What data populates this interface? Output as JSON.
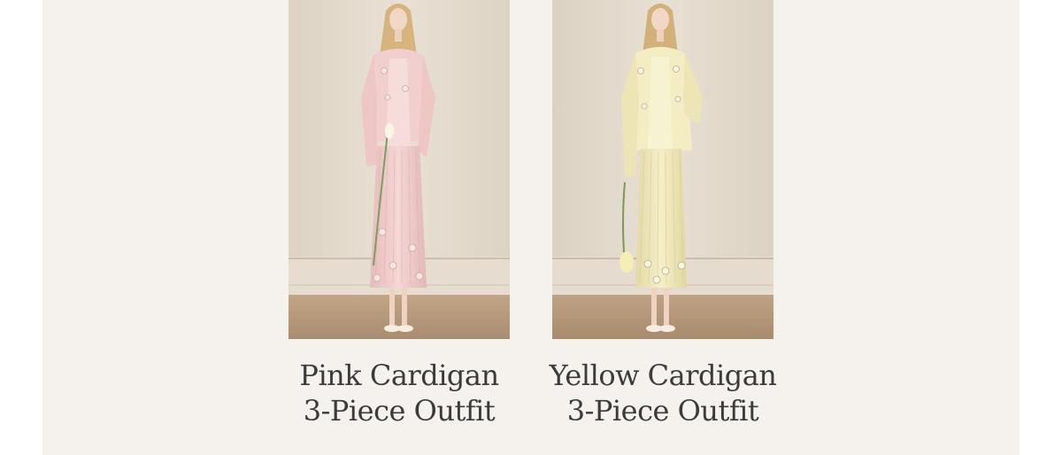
{
  "products": [
    {
      "title_line1": "Pink Cardigan",
      "title_line2": "3-Piece Outfit",
      "image_alt": "Model wearing pink knit cardigan, camisole and midi skirt set",
      "colors": {
        "wall": "#e4dccf",
        "floor": "#b79a7c",
        "garment": "#f1cfcd",
        "garment_shadow": "#e2b6b6"
      }
    },
    {
      "title_line1": "Yellow Cardigan",
      "title_line2": "3-Piece Outfit",
      "image_alt": "Model wearing yellow knit cardigan, camisole and midi skirt set",
      "colors": {
        "wall": "#e2dacc",
        "floor": "#b3987b",
        "garment": "#f3edc2",
        "garment_shadow": "#e1d8a4"
      }
    }
  ],
  "colors": {
    "panel_background": "#f5f2ee",
    "page_background": "#ffffff",
    "caption_text": "#3b3b3b"
  }
}
